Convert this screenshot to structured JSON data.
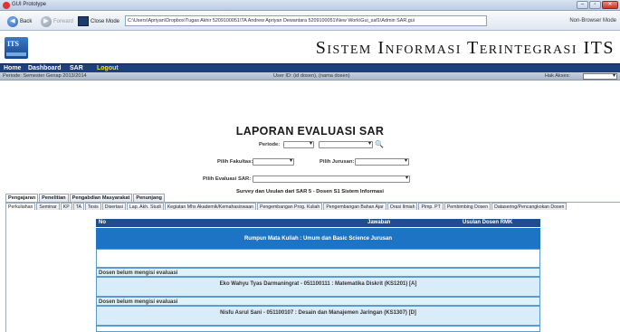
{
  "window": {
    "title": "GUI Prototype"
  },
  "toolbar": {
    "back_label": "Back",
    "forward_label": "Forward",
    "close_mode_label": "Close Mode",
    "address": "C:\\Users\\Apriyan\\Dropbox\\Tugas Akhir 5209100051\\TA Andrew Apriyan Dewantara 5209100051\\New Work\\Gui_saf1\\Admin SAR.gui",
    "mode": "Non-Browser Mode"
  },
  "header": {
    "system_name": "Sistem Informasi Terintegrasi ITS",
    "logo_text": "ITS"
  },
  "menu": {
    "home": "Home",
    "dashboard": "Dashboard",
    "sar": "SAR",
    "logout": "Logout"
  },
  "infobar": {
    "period": "Periode: Semester Genap 2013/2014",
    "user": "User ID: (id dosen), (nama dosen)",
    "access_label": "Hak Akses:"
  },
  "report": {
    "title": "LAPORAN EVALUASI SAR",
    "period_label": "Periode:",
    "faculty_label": "Pilih Fakultas:",
    "department_label": "Pilih Jurusan:",
    "evaluation_label": "Pilih Evaluasi SAR:",
    "caption": "Survey dan Usulan dari SAR 5 - Dosen S1 Sistem Informasi"
  },
  "main_tabs": [
    "Pengajaran",
    "Penelitian",
    "Pengabdian Masyarakat",
    "Penunjang"
  ],
  "sub_tabs": [
    "Perkuliahan",
    "Seminar",
    "KP",
    "TA",
    "Tesis",
    "Disertasi",
    "Lap. Akh. Studi",
    "Kegiatan Mhs Akademik/Kemahasiswaan",
    "Pengembangan Prog. Kuliah",
    "Pengembangan Bahan Ajar",
    "Orasi Ilmiah",
    "Pimp. PT",
    "Pembimbing Dosen",
    "Datasering/Pencangkokan Dosen"
  ],
  "table": {
    "col_no": "No",
    "col_answer": "Jawaban",
    "col_proposal": "Usulan Dosen RMK",
    "group_title": "Rumpun Mata Kuliah : Umum dan Basic Science Jurusan",
    "rows": [
      {
        "status": "Dosen belum mengisi evaluasi",
        "course": "Eko Wahyu Tyas Darmaningrat - 051100111 : Matematika Diskrit (KS1201) [A]"
      },
      {
        "status": "Dosen belum mengisi evaluasi",
        "course": "Nisfu Asrul Sani - 051100107 : Desain dan Manajemen Jaringan (KS1307) [D]"
      }
    ]
  }
}
